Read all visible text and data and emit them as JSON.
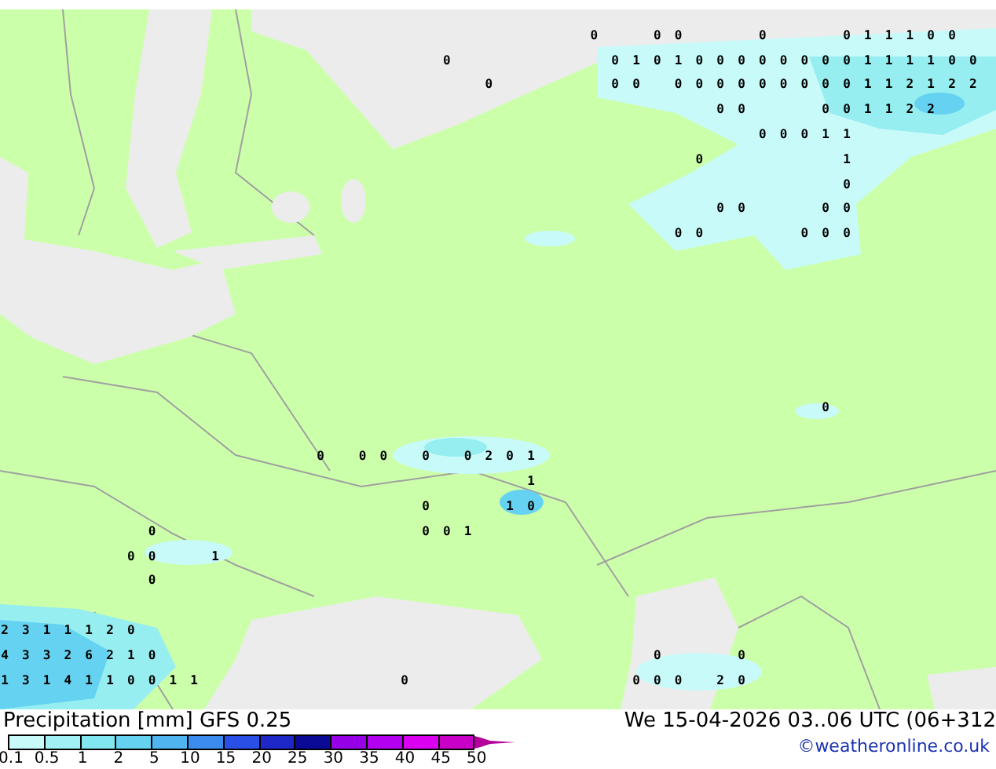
{
  "map": {
    "grid_rows": [
      null,
      [
        null,
        null,
        null,
        null,
        null,
        null,
        null,
        null,
        null,
        null,
        null,
        null,
        null,
        null,
        null,
        null,
        null,
        null,
        null,
        null,
        null,
        null,
        null,
        null,
        null,
        null,
        null,
        null,
        "0",
        null,
        null,
        "0",
        "0",
        null,
        null,
        null,
        "0",
        null,
        null,
        null,
        "0",
        "1",
        "1",
        "1",
        "0",
        "0"
      ],
      [
        null,
        null,
        null,
        null,
        null,
        null,
        null,
        null,
        null,
        null,
        null,
        null,
        null,
        null,
        null,
        null,
        null,
        null,
        null,
        null,
        null,
        "0",
        null,
        null,
        null,
        null,
        null,
        null,
        null,
        "0",
        "1",
        "0",
        "1",
        "0",
        "0",
        "0",
        "0",
        "0",
        "0",
        "0",
        "0",
        "1",
        "1",
        "1",
        "1",
        "0",
        "0"
      ],
      [
        null,
        null,
        null,
        null,
        null,
        null,
        null,
        null,
        null,
        null,
        null,
        null,
        null,
        null,
        null,
        null,
        null,
        null,
        null,
        null,
        null,
        null,
        null,
        "0",
        null,
        null,
        null,
        null,
        null,
        "0",
        "0",
        null,
        "0",
        "0",
        "0",
        "0",
        "0",
        "0",
        "0",
        "0",
        "0",
        "1",
        "1",
        "2",
        "1",
        "2",
        "2"
      ],
      [
        null,
        null,
        null,
        null,
        null,
        null,
        null,
        null,
        null,
        null,
        null,
        null,
        null,
        null,
        null,
        null,
        null,
        null,
        null,
        null,
        null,
        null,
        null,
        null,
        null,
        null,
        null,
        null,
        null,
        null,
        null,
        null,
        null,
        null,
        "0",
        "0",
        null,
        null,
        null,
        "0",
        "0",
        "1",
        "1",
        "2",
        "2"
      ],
      [
        null,
        null,
        null,
        null,
        null,
        null,
        null,
        null,
        null,
        null,
        null,
        null,
        null,
        null,
        null,
        null,
        null,
        null,
        null,
        null,
        null,
        null,
        null,
        null,
        null,
        null,
        null,
        null,
        null,
        null,
        null,
        null,
        null,
        null,
        null,
        null,
        "0",
        "0",
        "0",
        "1",
        "1"
      ],
      [
        null,
        null,
        null,
        null,
        null,
        null,
        null,
        null,
        null,
        null,
        null,
        null,
        null,
        null,
        null,
        null,
        null,
        null,
        null,
        null,
        null,
        null,
        null,
        null,
        null,
        null,
        null,
        null,
        null,
        null,
        null,
        null,
        null,
        "0",
        null,
        null,
        null,
        null,
        null,
        null,
        "1"
      ],
      [
        null,
        null,
        null,
        null,
        null,
        null,
        null,
        null,
        null,
        null,
        null,
        null,
        null,
        null,
        null,
        null,
        null,
        null,
        null,
        null,
        null,
        null,
        null,
        null,
        null,
        null,
        null,
        null,
        null,
        null,
        null,
        null,
        null,
        null,
        null,
        null,
        null,
        null,
        null,
        null,
        "0"
      ],
      [
        null,
        null,
        null,
        null,
        null,
        null,
        null,
        null,
        null,
        null,
        null,
        null,
        null,
        null,
        null,
        null,
        null,
        null,
        null,
        null,
        null,
        null,
        null,
        null,
        null,
        null,
        null,
        null,
        null,
        null,
        null,
        null,
        null,
        null,
        "0",
        "0",
        null,
        null,
        null,
        "0",
        "0"
      ],
      [
        null,
        null,
        null,
        null,
        null,
        null,
        null,
        null,
        null,
        null,
        null,
        null,
        null,
        null,
        null,
        null,
        null,
        null,
        null,
        null,
        null,
        null,
        null,
        null,
        null,
        null,
        null,
        null,
        null,
        null,
        null,
        null,
        "0",
        "0",
        null,
        null,
        null,
        null,
        "0",
        "0",
        "0"
      ],
      null,
      null,
      null,
      null,
      null,
      null,
      [
        null,
        null,
        null,
        null,
        null,
        null,
        null,
        null,
        null,
        null,
        null,
        null,
        null,
        null,
        null,
        null,
        null,
        null,
        null,
        null,
        null,
        null,
        null,
        null,
        null,
        null,
        null,
        null,
        null,
        null,
        null,
        null,
        null,
        null,
        null,
        null,
        null,
        null,
        null,
        "0"
      ],
      null,
      [
        null,
        null,
        null,
        null,
        null,
        null,
        null,
        null,
        null,
        null,
        null,
        null,
        null,
        null,
        null,
        "0",
        null,
        "0",
        "0",
        null,
        "0",
        null,
        "0",
        "2",
        "0",
        "1"
      ],
      [
        null,
        null,
        null,
        null,
        null,
        null,
        null,
        null,
        null,
        null,
        null,
        null,
        null,
        null,
        null,
        null,
        null,
        null,
        null,
        null,
        null,
        null,
        null,
        null,
        null,
        "1"
      ],
      [
        null,
        null,
        null,
        null,
        null,
        null,
        null,
        null,
        null,
        null,
        null,
        null,
        null,
        null,
        null,
        null,
        null,
        null,
        null,
        null,
        "0",
        null,
        null,
        null,
        "1",
        "0"
      ],
      [
        null,
        null,
        null,
        null,
        null,
        null,
        null,
        "0",
        null,
        null,
        null,
        null,
        null,
        null,
        null,
        null,
        null,
        null,
        null,
        null,
        "0",
        "0",
        "1"
      ],
      [
        null,
        null,
        null,
        null,
        null,
        null,
        "0",
        "0",
        null,
        null,
        "1"
      ],
      [
        null,
        null,
        null,
        null,
        null,
        null,
        null,
        "0"
      ],
      null,
      [
        "2",
        "3",
        "1",
        "1",
        "1",
        "2",
        "0"
      ],
      [
        "4",
        "3",
        "3",
        "2",
        "6",
        "2",
        "1",
        "0",
        null,
        null,
        null,
        null,
        null,
        null,
        null,
        null,
        null,
        null,
        null,
        null,
        null,
        null,
        null,
        null,
        null,
        null,
        null,
        null,
        null,
        null,
        null,
        "0",
        null,
        null,
        null,
        "0"
      ],
      [
        "1",
        "3",
        "1",
        "4",
        "1",
        "1",
        "0",
        "0",
        "1",
        "1",
        null,
        null,
        null,
        null,
        null,
        null,
        null,
        null,
        null,
        "0",
        null,
        null,
        null,
        null,
        null,
        null,
        null,
        null,
        null,
        null,
        "0",
        "0",
        "0",
        null,
        "2",
        "0"
      ]
    ]
  },
  "legend": {
    "title": "Precipitation [mm] GFS 0.25",
    "datetime": "We 15-04-2026 03..06 UTC (06+312",
    "credit": "©weatheronline.co.uk",
    "scale": [
      {
        "kind": "box",
        "color": "#c8fafa"
      },
      {
        "kind": "box",
        "color": "#a0f0f5"
      },
      {
        "kind": "box",
        "color": "#82e6f0"
      },
      {
        "kind": "box",
        "color": "#64d2f0"
      },
      {
        "kind": "box",
        "color": "#50b4f0"
      },
      {
        "kind": "box",
        "color": "#3c8cf0"
      },
      {
        "kind": "box",
        "color": "#2850e6"
      },
      {
        "kind": "box",
        "color": "#1e28c8"
      },
      {
        "kind": "box",
        "color": "#0a0a96"
      },
      {
        "kind": "box",
        "color": "#9600e6"
      },
      {
        "kind": "box",
        "color": "#b400f0"
      },
      {
        "kind": "box",
        "color": "#dc00f0"
      },
      {
        "kind": "box",
        "color": "#c800c8"
      },
      {
        "kind": "arrow",
        "color": "#b4009b"
      }
    ],
    "scale_labels": [
      "0.1",
      "0.5",
      "1",
      "2",
      "5",
      "10",
      "15",
      "20",
      "25",
      "30",
      "35",
      "40",
      "45",
      "50"
    ]
  }
}
